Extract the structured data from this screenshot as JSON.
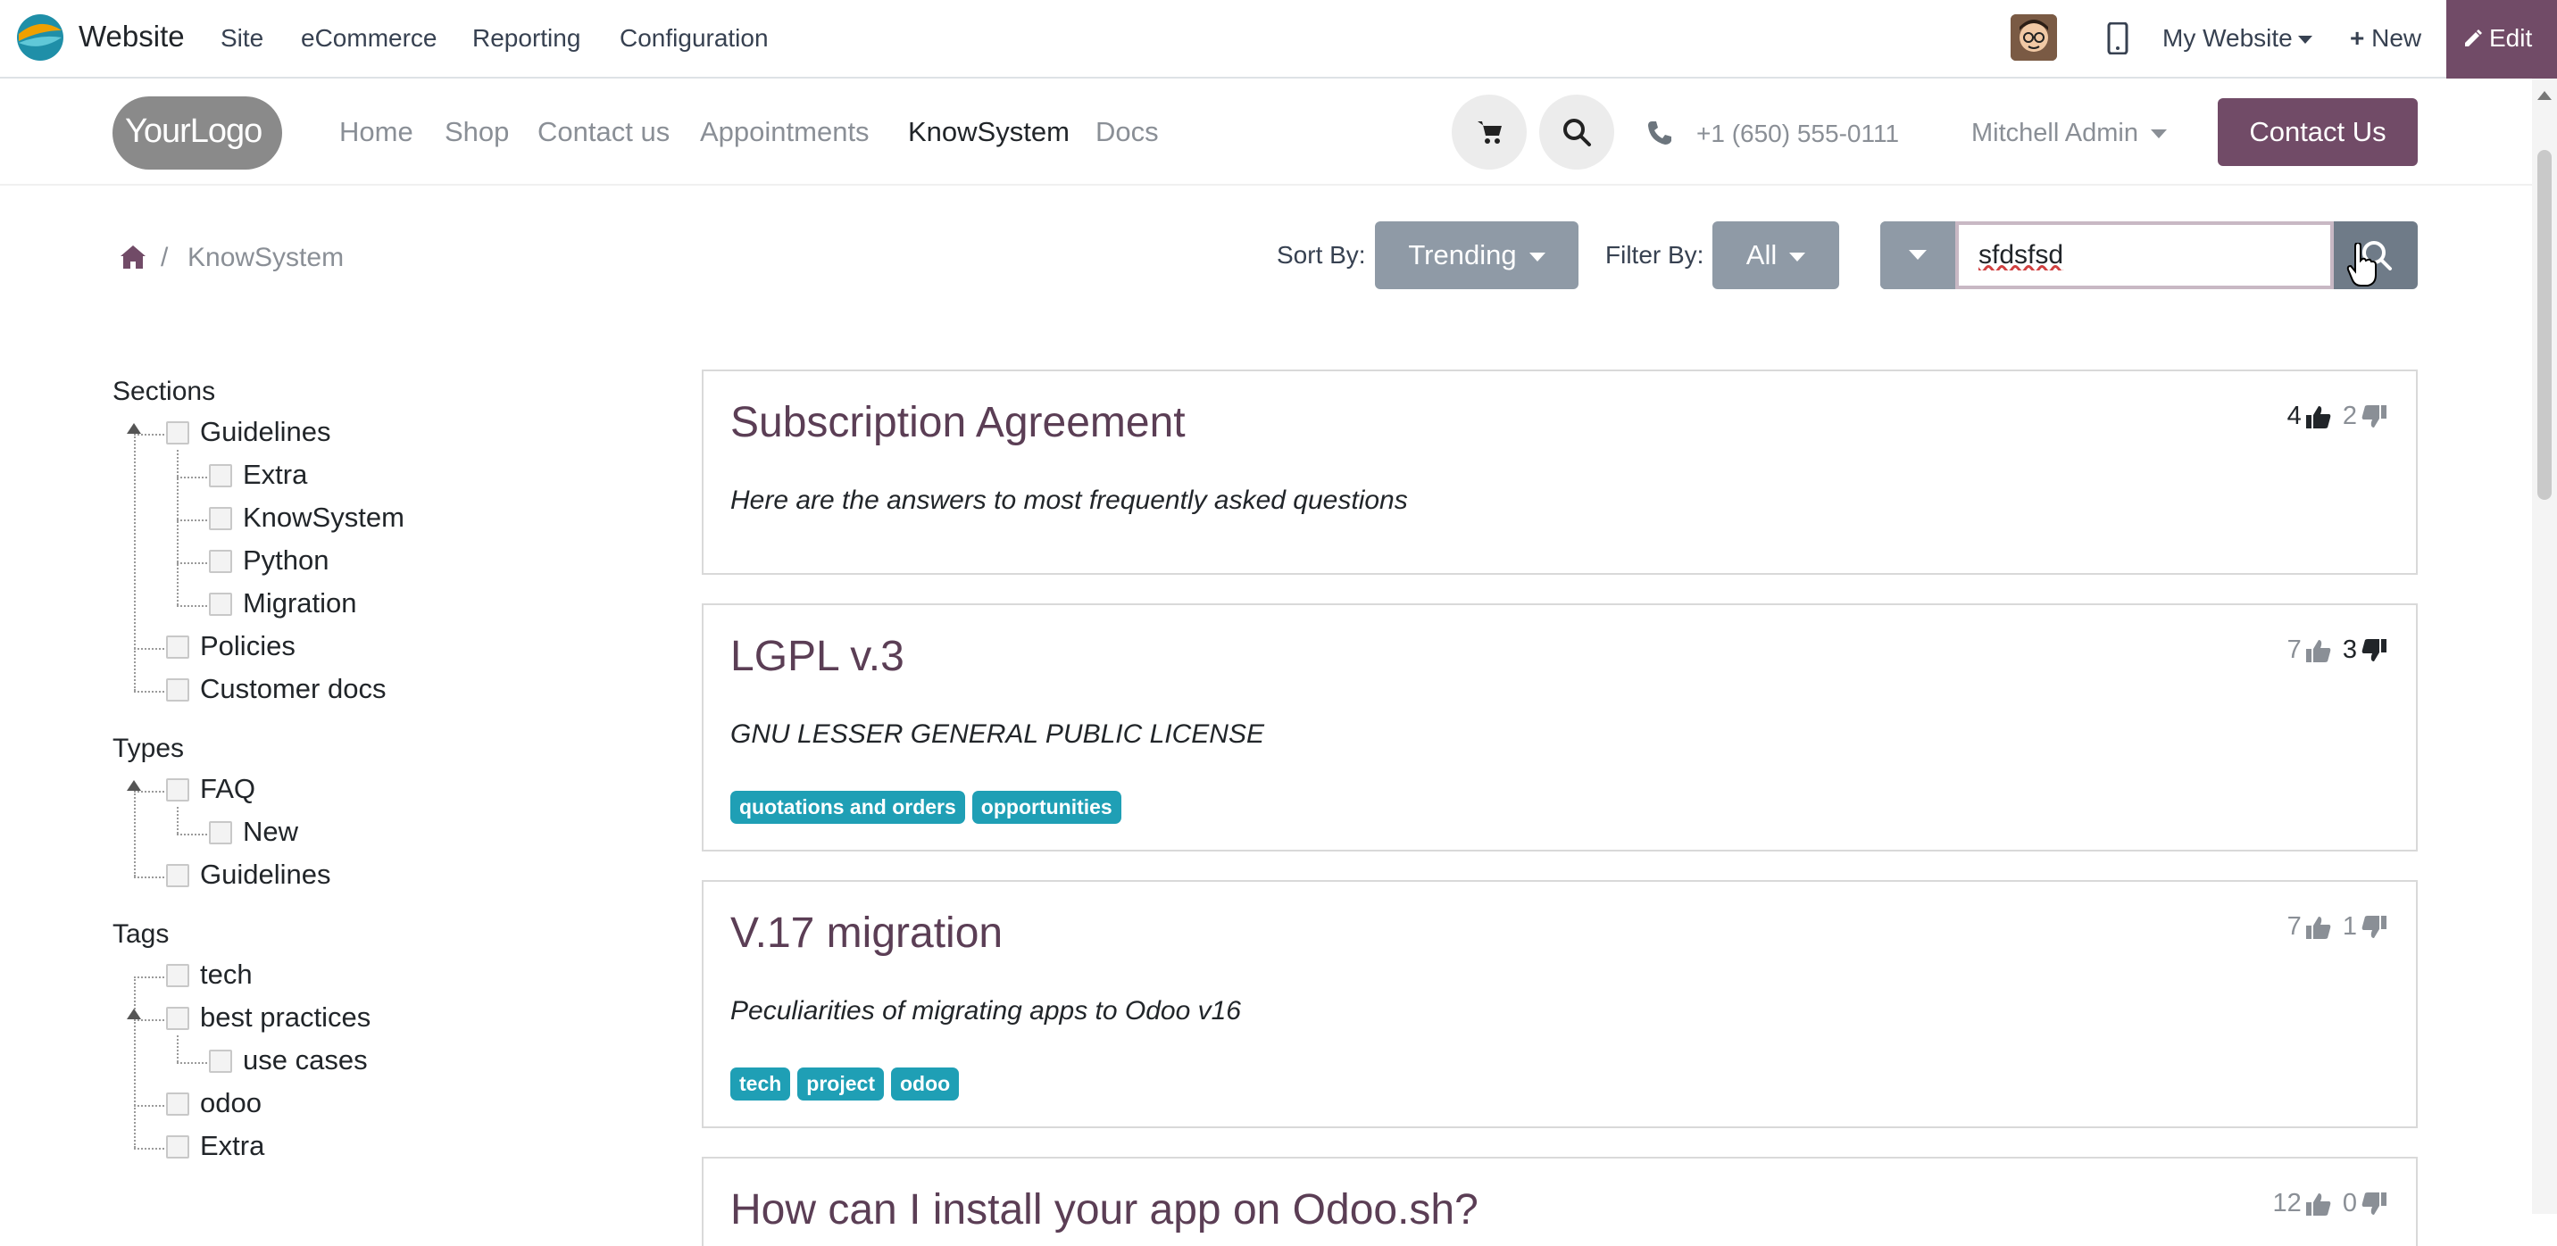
{
  "topbar": {
    "app_name": "Website",
    "menu": [
      "Site",
      "eCommerce",
      "Reporting",
      "Configuration"
    ],
    "my_website": "My Website",
    "new_label": "New",
    "edit_label": "Edit"
  },
  "header": {
    "logo_text": "YourLogo",
    "nav": [
      "Home",
      "Shop",
      "Contact us",
      "Appointments",
      "KnowSystem",
      "Docs"
    ],
    "active_nav": "KnowSystem",
    "phone": "+1 (650) 555-0111",
    "user": "Mitchell Admin",
    "contact_button": "Contact Us"
  },
  "toolbar": {
    "breadcrumb_sep": "/",
    "breadcrumb_current": "KnowSystem",
    "sort_label": "Sort By:",
    "sort_value": "Trending",
    "filter_label": "Filter By:",
    "filter_value": "All",
    "search_value": "sfdsfsd"
  },
  "sidebar": {
    "sections_title": "Sections",
    "sections": [
      "Guidelines",
      "Extra",
      "KnowSystem",
      "Python",
      "Migration",
      "Policies",
      "Customer docs"
    ],
    "types_title": "Types",
    "types": [
      "FAQ",
      "New",
      "Guidelines"
    ],
    "tags_title": "Tags",
    "tags": [
      "tech",
      "best practices",
      "use cases",
      "odoo",
      "Extra"
    ]
  },
  "articles": [
    {
      "title": "Subscription Agreement",
      "summary": "Here are the answers to most frequently asked questions",
      "likes": "4",
      "dislikes": "2",
      "tags": []
    },
    {
      "title": "LGPL v.3",
      "summary": "GNU LESSER GENERAL PUBLIC LICENSE",
      "likes": "7",
      "dislikes": "3",
      "tags": [
        "quotations and orders",
        "opportunities"
      ]
    },
    {
      "title": "V.17 migration",
      "summary": "Peculiarities of migrating apps to Odoo v16",
      "likes": "7",
      "dislikes": "1",
      "tags": [
        "tech",
        "project",
        "odoo"
      ]
    },
    {
      "title": "How can I install your app on Odoo.sh?",
      "likes": "12",
      "dislikes": "0"
    }
  ],
  "colors": {
    "brand": "#714b67",
    "tag": "#1f9fb5",
    "gray_button": "#8f9aa6"
  }
}
